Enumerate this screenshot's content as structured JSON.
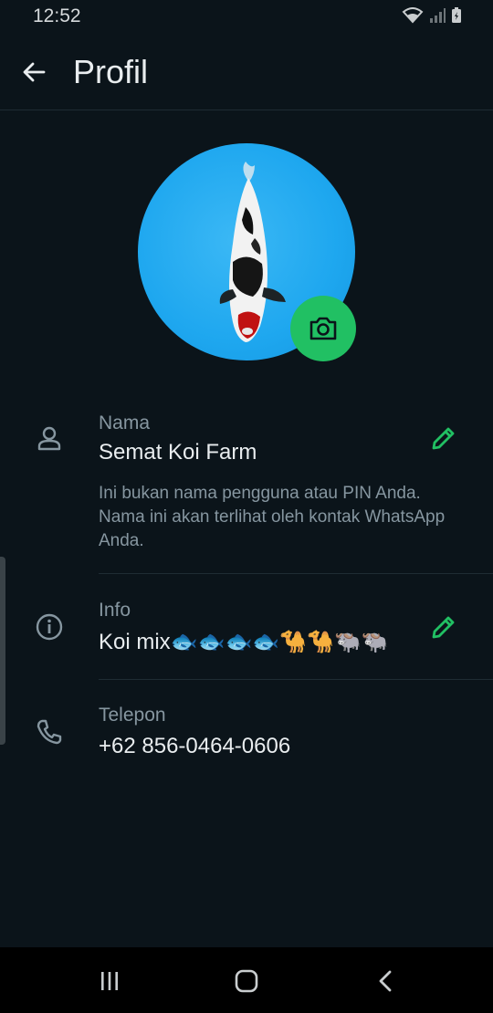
{
  "status_bar": {
    "time": "12:52"
  },
  "appbar": {
    "title": "Profil"
  },
  "profile": {
    "name_label": "Nama",
    "name_value": "Semat Koi Farm",
    "name_hint": "Ini bukan nama pengguna atau PIN Anda. Nama ini akan terlihat oleh kontak WhatsApp Anda.",
    "info_label": "Info",
    "info_value": "Koi mix🐟🐟🐟🐟🐪🐪🐃🐃",
    "phone_label": "Telepon",
    "phone_value": "+62 856-0464-0606"
  },
  "colors": {
    "accent": "#21c063",
    "background": "#0b141a",
    "secondary_text": "#8696a0"
  },
  "icons": [
    "wifi-icon",
    "signal-icon",
    "battery-icon",
    "back-arrow-icon",
    "camera-icon",
    "person-icon",
    "info-icon",
    "phone-icon",
    "pencil-icon",
    "recents-icon",
    "home-icon",
    "back-nav-icon"
  ]
}
